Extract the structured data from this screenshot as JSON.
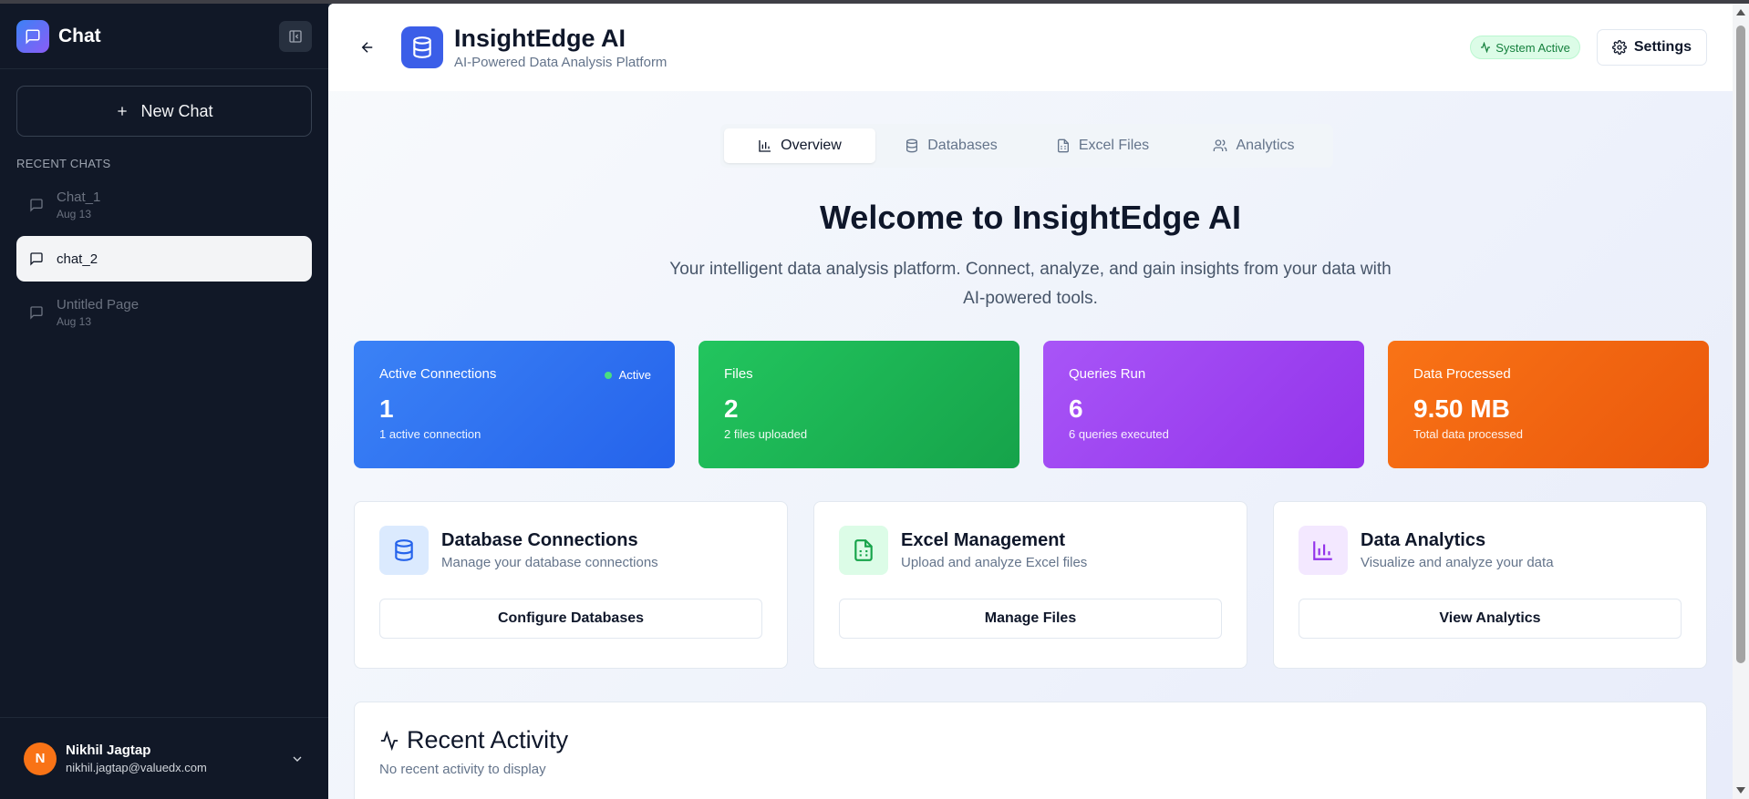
{
  "sidebar": {
    "title": "Chat",
    "new_chat": "New Chat",
    "recent_label": "RECENT CHATS",
    "chats": [
      {
        "name": "Chat_1",
        "date": "Aug 13"
      },
      {
        "name": "chat_2",
        "date": ""
      },
      {
        "name": "Untitled Page",
        "date": "Aug 13"
      }
    ],
    "user": {
      "initial": "N",
      "name": "Nikhil Jagtap",
      "email": "nikhil.jagtap@valuedx.com"
    }
  },
  "header": {
    "title": "InsightEdge AI",
    "subtitle": "AI-Powered Data Analysis Platform",
    "status": "System Active",
    "settings": "Settings"
  },
  "tabs": [
    {
      "label": "Overview",
      "icon": "bar-chart-icon"
    },
    {
      "label": "Databases",
      "icon": "database-icon"
    },
    {
      "label": "Excel Files",
      "icon": "file-spreadsheet-icon"
    },
    {
      "label": "Analytics",
      "icon": "users-icon"
    }
  ],
  "welcome": {
    "title": "Welcome to InsightEdge AI",
    "text": "Your intelligent data analysis platform. Connect, analyze, and gain insights from your data with AI-powered tools."
  },
  "stats": [
    {
      "label": "Active Connections",
      "value": "1",
      "note": "1 active connection",
      "badge": "Active",
      "color": "#2f6ce8"
    },
    {
      "label": "Files",
      "value": "2",
      "note": "2 files uploaded",
      "color": "#1cae4a"
    },
    {
      "label": "Queries Run",
      "value": "6",
      "note": "6 queries executed",
      "color": "#9a36ea"
    },
    {
      "label": "Data Processed",
      "value": "9.50 MB",
      "note": "Total data processed",
      "color": "#ef6317"
    }
  ],
  "cards": [
    {
      "title": "Database Connections",
      "desc": "Manage your database connections",
      "button": "Configure Databases"
    },
    {
      "title": "Excel Management",
      "desc": "Upload and analyze Excel files",
      "button": "Manage Files"
    },
    {
      "title": "Data Analytics",
      "desc": "Visualize and analyze your data",
      "button": "View Analytics"
    }
  ],
  "activity": {
    "title": "Recent Activity",
    "empty": "No recent activity to display"
  }
}
